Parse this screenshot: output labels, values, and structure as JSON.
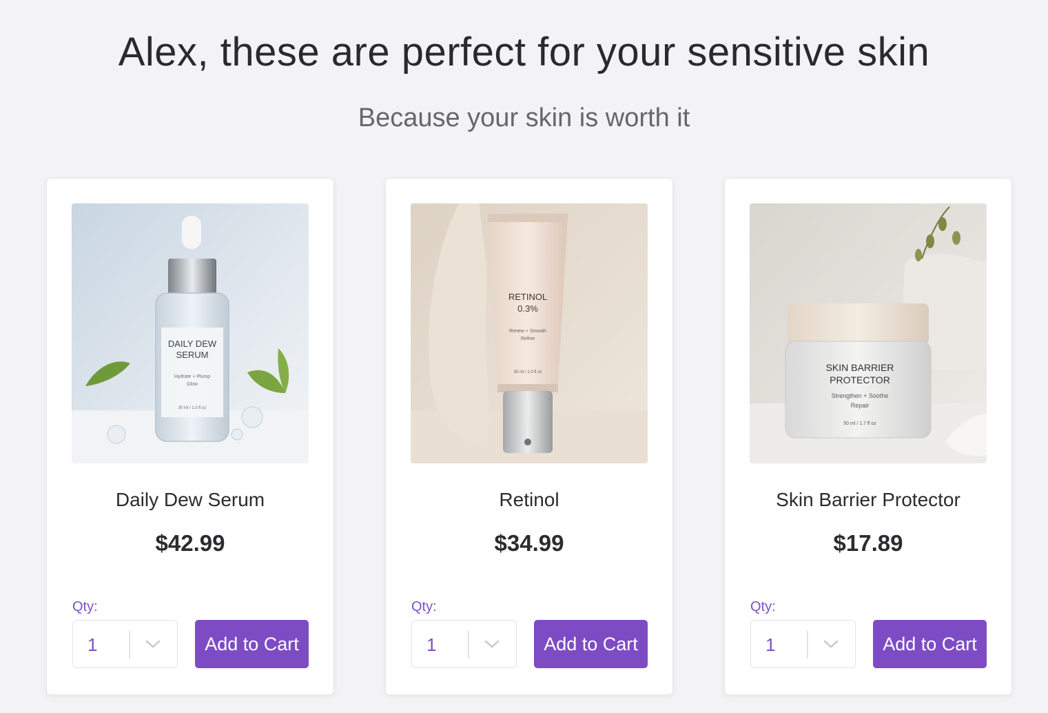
{
  "header": {
    "title": "Alex, these are perfect for your sensitive skin",
    "subtitle": "Because your skin is worth it"
  },
  "products": [
    {
      "name": "Daily Dew Serum",
      "price": "$42.99",
      "qty_label": "Qty:",
      "qty_value": "1",
      "cta": "Add to Cart",
      "image_label": {
        "line1": "DAILY DEW",
        "line2": "SERUM",
        "tag": "Hydrate + Plump",
        "tag2": "Glow",
        "size": "30 ml / 1.0 fl oz"
      }
    },
    {
      "name": "Retinol",
      "price": "$34.99",
      "qty_label": "Qty:",
      "qty_value": "1",
      "cta": "Add to Cart",
      "image_label": {
        "line1": "RETINOL",
        "line2": "0.3%",
        "tag": "Renew + Smooth",
        "tag2": "Refine",
        "size": "30 ml / 1.0 fl oz"
      }
    },
    {
      "name": "Skin Barrier Protector",
      "price": "$17.89",
      "qty_label": "Qty:",
      "qty_value": "1",
      "cta": "Add to Cart",
      "image_label": {
        "line1": "SKIN BARRIER",
        "line2": "PROTECTOR",
        "tag": "Strengthen + Soothe",
        "tag2": "Repair",
        "size": "50 ml / 1.7 fl oz"
      }
    }
  ],
  "colors": {
    "accent": "#7d4cc4",
    "background": "#f3f3f5"
  }
}
